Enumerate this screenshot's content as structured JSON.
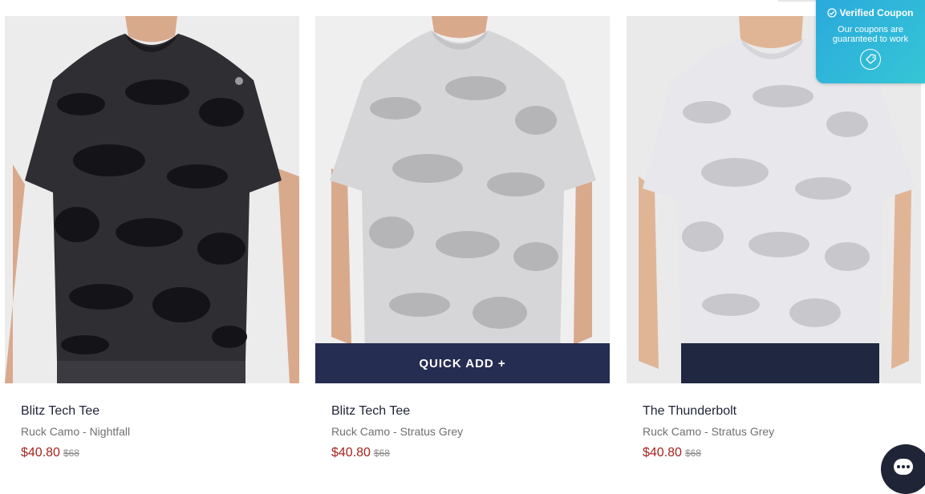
{
  "products": [
    {
      "name": "Blitz Tech Tee",
      "variant": "Ruck Camo - Nightfall",
      "price": "$40.80",
      "compare_price": "$68",
      "colors": {
        "background": "#ececec",
        "shirt": "#2f2f33",
        "camo": "#141418",
        "skin": "#d9a98c",
        "pants": "#3a3a40"
      }
    },
    {
      "name": "Blitz Tech Tee",
      "variant": "Ruck Camo - Stratus Grey",
      "price": "$40.80",
      "compare_price": "$68",
      "quick_add_label": "QUICK ADD +",
      "colors": {
        "background": "#efefef",
        "shirt": "#d6d6d8",
        "camo": "#b5b5b8",
        "skin": "#d9a98c",
        "pants": "#5a5a5a"
      }
    },
    {
      "name": "The Thunderbolt",
      "variant": "Ruck Camo - Stratus Grey",
      "price": "$40.80",
      "compare_price": "$68",
      "colors": {
        "background": "#eaeaea",
        "shirt": "#e7e7ec",
        "camo": "#c7c7cc",
        "skin": "#e0b596",
        "pants": "#1f2840"
      }
    }
  ],
  "coupon": {
    "title": "Verified Coupon",
    "subtitle": "Our coupons are guaranteed to work",
    "icon": "coupon-tag-icon"
  },
  "chat": {
    "icon": "chat-bubble-icon",
    "color": "#1f2437"
  },
  "colors": {
    "price": "#a3241e",
    "quick_add_bg": "#262d52",
    "coupon_gradient_start": "#2aa9dc",
    "coupon_gradient_end": "#36c6d6"
  }
}
